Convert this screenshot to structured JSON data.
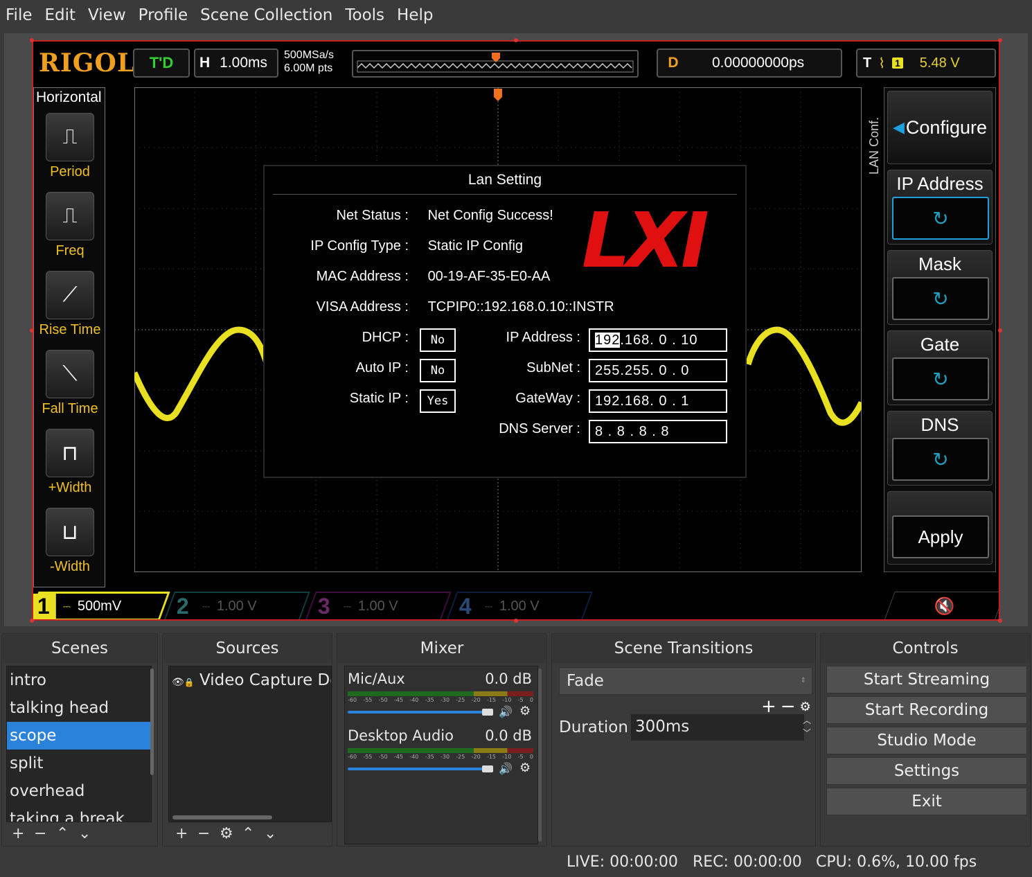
{
  "menu": [
    "File",
    "Edit",
    "View",
    "Profile",
    "Scene Collection",
    "Tools",
    "Help"
  ],
  "scope": {
    "brand": "RIGOL",
    "run_state": "T'D",
    "horizontal": {
      "label": "H",
      "value": "1.00ms"
    },
    "sample_rate": "500MSa/s",
    "memory_depth": "6.00M pts",
    "delay": {
      "label": "D",
      "value": "0.00000000ps"
    },
    "trigger": {
      "label": "T",
      "source": "1",
      "level": "5.48 V"
    },
    "measure_panel": {
      "title": "Horizontal",
      "items": [
        "Period",
        "Freq",
        "Rise Time",
        "Fall Time",
        "+Width",
        "-Width"
      ]
    },
    "lan": {
      "title": "Lan Setting",
      "net_status": {
        "label": "Net Status :",
        "value": "Net Config Success!"
      },
      "ip_config_type": {
        "label": "IP Config Type :",
        "value": "Static IP Config"
      },
      "mac_address": {
        "label": "MAC Address :",
        "value": "00-19-AF-35-E0-AA"
      },
      "visa_address": {
        "label": "VISA Address :",
        "value": "TCPIP0::192.168.0.10::INSTR"
      },
      "dhcp": {
        "label": "DHCP :",
        "value": "No"
      },
      "auto_ip": {
        "label": "Auto IP :",
        "value": "No"
      },
      "static_ip": {
        "label": "Static IP :",
        "value": "Yes"
      },
      "ip_address": {
        "label": "IP Address :",
        "highlight": "192",
        "rest": ".168. 0 . 10"
      },
      "subnet": {
        "label": "SubNet :",
        "value": "255.255. 0 . 0"
      },
      "gateway": {
        "label": "GateWay :",
        "value": "192.168. 0 . 1"
      },
      "dns_server": {
        "label": "DNS Server :",
        "value": "8 . 8 . 8 . 8"
      },
      "logo": "LXI"
    },
    "softkeys": {
      "menu_title": "LAN Conf.",
      "configure": "Configure",
      "ip_address": "IP Address",
      "mask": "Mask",
      "gate": "Gate",
      "dns": "DNS",
      "apply": "Apply"
    },
    "channels": [
      {
        "num": "1",
        "value": "500mV",
        "color": "#e8e020"
      },
      {
        "num": "2",
        "value": "1.00 V",
        "color": "#1fb8b8"
      },
      {
        "num": "3",
        "value": "1.00 V",
        "color": "#c020c0"
      },
      {
        "num": "4",
        "value": "1.00 V",
        "color": "#2060d0"
      }
    ]
  },
  "scenes": {
    "title": "Scenes",
    "items": [
      "intro",
      "talking head",
      "scope",
      "split",
      "overhead",
      "taking a break"
    ],
    "selected": "scope"
  },
  "sources": {
    "title": "Sources",
    "items": [
      "Video Capture De"
    ]
  },
  "mixer": {
    "title": "Mixer",
    "channels": [
      {
        "name": "Mic/Aux",
        "level": "0.0 dB"
      },
      {
        "name": "Desktop Audio",
        "level": "0.0 dB"
      }
    ],
    "scale": [
      "-60",
      "-55",
      "-50",
      "-45",
      "-40",
      "-35",
      "-30",
      "-25",
      "-20",
      "-15",
      "-10",
      "-5",
      "0"
    ]
  },
  "transitions": {
    "title": "Scene Transitions",
    "selected": "Fade",
    "duration_label": "Duration",
    "duration_value": "300ms"
  },
  "controls": {
    "title": "Controls",
    "buttons": [
      "Start Streaming",
      "Start Recording",
      "Studio Mode",
      "Settings",
      "Exit"
    ]
  },
  "status": {
    "live": "LIVE: 00:00:00",
    "rec": "REC: 00:00:00",
    "cpu": "CPU: 0.6%, 10.00 fps"
  }
}
